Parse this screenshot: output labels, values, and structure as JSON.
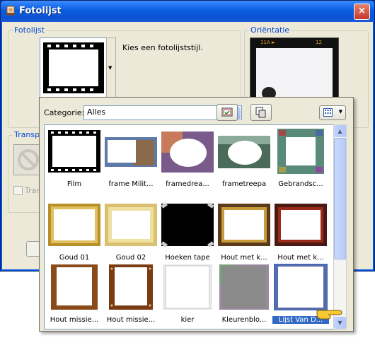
{
  "window": {
    "title": "Fotolijst",
    "close_label": "×"
  },
  "groups": {
    "frame": "Fotolijst",
    "orientation": "Oriëntatie",
    "transparency": "Transpa"
  },
  "hint_text": "Kies een fotolijststijl.",
  "orientation_preview": {
    "marks": [
      "11A ►",
      "12"
    ]
  },
  "transparency_label": "Tran",
  "popup": {
    "category_label": "Categorie:",
    "category_value": "Alles",
    "items": [
      {
        "label": "Film",
        "style": "film"
      },
      {
        "label": "frame Milit...",
        "style": "photo-castle"
      },
      {
        "label": "framedrea...",
        "style": "photo-dream"
      },
      {
        "label": "frametreepa",
        "style": "photo-tree"
      },
      {
        "label": "Gebrandsc...",
        "style": "stained-glass"
      },
      {
        "label": "Goud 01",
        "style": "gold"
      },
      {
        "label": "Goud 02",
        "style": "gold-light"
      },
      {
        "label": "Hoeken tape",
        "style": "black-tape"
      },
      {
        "label": "Hout met k...",
        "style": "wood-gold"
      },
      {
        "label": "Hout met k...",
        "style": "wood-red"
      },
      {
        "label": "Hout missie...",
        "style": "mission-wood"
      },
      {
        "label": "Hout missie...",
        "style": "mission-wood-dark"
      },
      {
        "label": "kier",
        "style": "crack"
      },
      {
        "label": "Kleurenblo...",
        "style": "color-blocks"
      },
      {
        "label": "Lijst Van D...",
        "style": "blue-soft",
        "selected": true
      }
    ]
  },
  "colors": {
    "accent": "#316ac5",
    "titlebar": "#0a5ddf",
    "group_label": "#0046d5"
  }
}
